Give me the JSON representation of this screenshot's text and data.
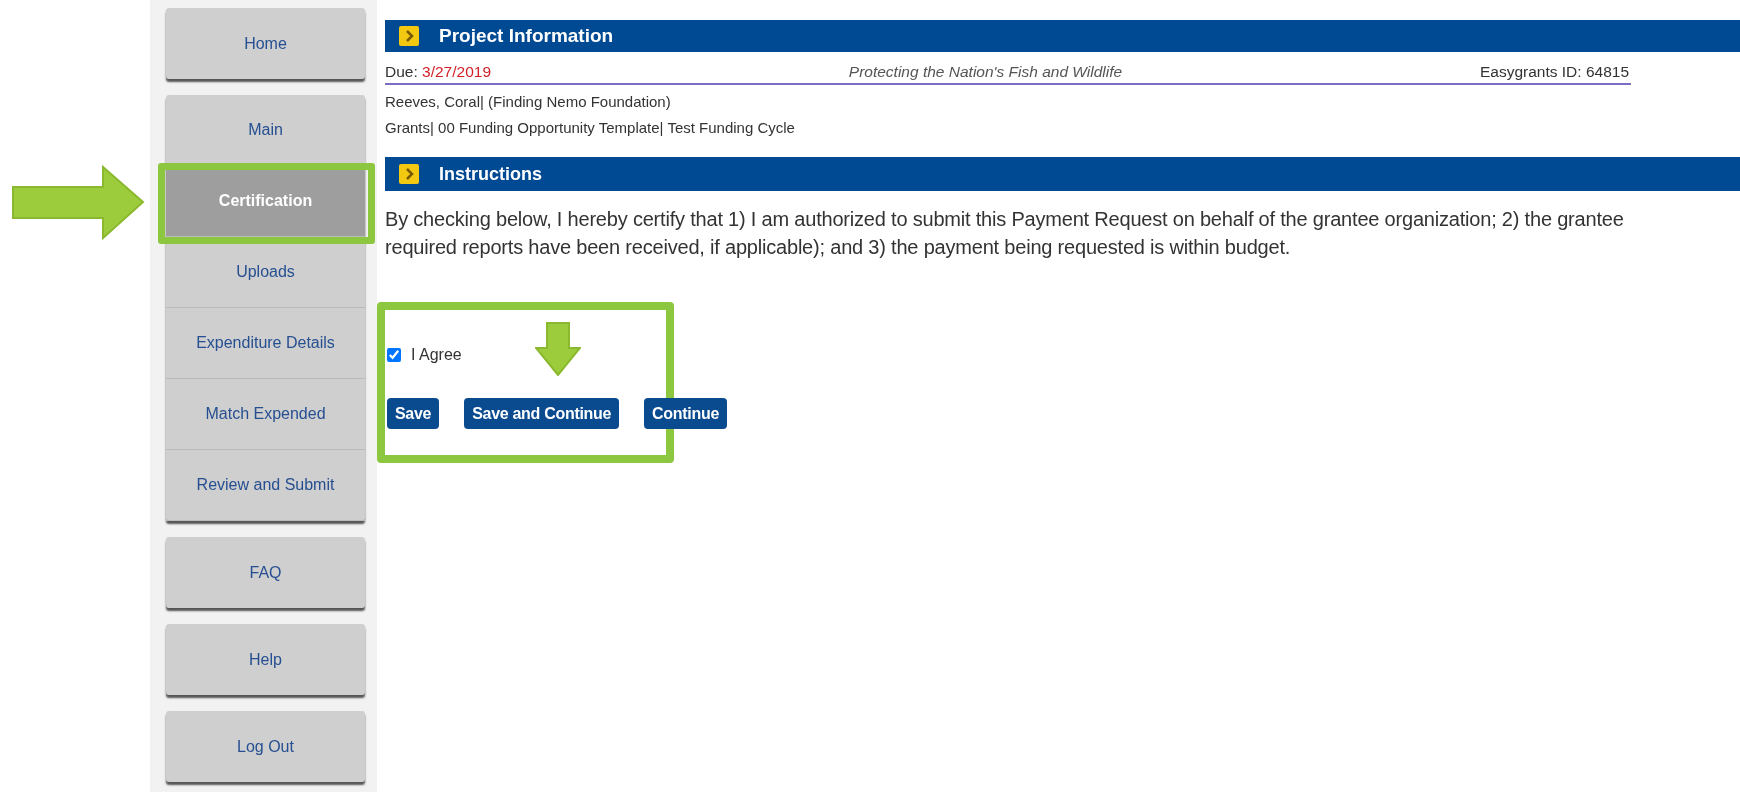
{
  "sidebar": {
    "groups": [
      {
        "items": [
          {
            "label": "Home",
            "selected": false
          }
        ]
      },
      {
        "items": [
          {
            "label": "Main",
            "selected": false
          },
          {
            "label": "Certification",
            "selected": true
          },
          {
            "label": "Uploads",
            "selected": false
          },
          {
            "label": "Expenditure Details",
            "selected": false
          },
          {
            "label": "Match Expended",
            "selected": false
          },
          {
            "label": "Review and Submit",
            "selected": false
          }
        ]
      },
      {
        "items": [
          {
            "label": "FAQ",
            "selected": false
          }
        ]
      },
      {
        "items": [
          {
            "label": "Help",
            "selected": false
          }
        ]
      },
      {
        "items": [
          {
            "label": "Log Out",
            "selected": false
          }
        ]
      }
    ]
  },
  "project_information": {
    "heading": "Project Information",
    "due_label": "Due:",
    "due_date": "3/27/2019",
    "program": "Protecting the Nation's Fish and Wildlife",
    "easygrants_id": "Easygrants ID: 64815",
    "applicant": "Reeves, Coral| (Finding Nemo Foundation)",
    "funding": "Grants| 00 Funding Opportunity Template| Test Funding Cycle"
  },
  "instructions": {
    "heading": "Instructions",
    "lines": [
      "By checking below, I hereby certify that 1) I am authorized to submit this Payment Request on behalf of the grantee organization; 2) the grantee",
      "required reports have been received, if applicable); and 3) the payment being requested is within budget."
    ]
  },
  "agreement": {
    "label": "I Agree",
    "checked": true
  },
  "buttons": [
    "Save",
    "Save and Continue",
    "Continue"
  ]
}
